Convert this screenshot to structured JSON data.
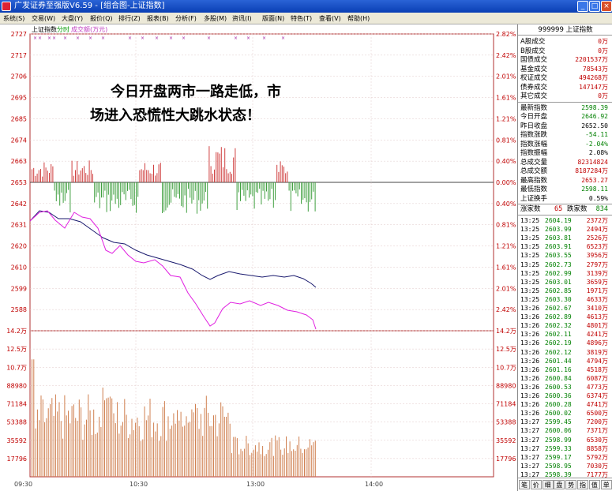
{
  "window": {
    "title": "广发证券至强版V6.59 - [组合图-上证指数]",
    "btn_min": "_",
    "btn_max": "□",
    "btn_close": "×"
  },
  "menu": [
    "系统(S)",
    "交易(W)",
    "大盘(Y)",
    "报价(Q)",
    "排行(Z)",
    "报表(B)",
    "分析(F)",
    "多股(M)",
    "资讯(I)",
    "版面(N)",
    "特色(T)",
    "查看(V)",
    "帮助(H)"
  ],
  "chart": {
    "index_name": "上证指数",
    "mode": "分时",
    "volume_label": "成交额(万元)",
    "price_ticks": [
      "2727",
      "2717",
      "2706",
      "2695",
      "2685",
      "2674",
      "2663",
      "2653",
      "2642",
      "2631",
      "2620",
      "2610",
      "2599",
      "2588"
    ],
    "pct_ticks": [
      "2.82%",
      "2.42%",
      "2.01%",
      "1.61%",
      "1.21%",
      "0.81%",
      "0.40%",
      "0.00%",
      "0.40%",
      "0.81%",
      "1.21%",
      "1.61%",
      "2.01%",
      "2.42%"
    ],
    "vol_ticks": [
      "14.2万",
      "12.5万",
      "10.7万",
      "88980",
      "71184",
      "53388",
      "35592",
      "17796"
    ],
    "time_ticks": [
      "09:30",
      "10:30",
      "13:00",
      "14:00"
    ],
    "series_colors": {
      "index": "#1a1a6e",
      "avg": "#e020e0",
      "up": "#d04040",
      "down": "#40a040",
      "volume": "#d08050"
    }
  },
  "annotation": {
    "line1": "今日开盘两市一路走低，市",
    "line2": "场进入恐慌性大跳水状态！"
  },
  "panel": {
    "code": "999999",
    "name": "上证指数",
    "rows": [
      {
        "k": "A股成交",
        "v": "0万",
        "c": "red"
      },
      {
        "k": "B股成交",
        "v": "0万",
        "c": "red"
      },
      {
        "k": "国债成交",
        "v": "2201537万",
        "c": "red"
      },
      {
        "k": "基金成交",
        "v": "78543万",
        "c": "red"
      },
      {
        "k": "权证成交",
        "v": "494268万",
        "c": "red"
      },
      {
        "k": "债券成交",
        "v": "147147万",
        "c": "red"
      },
      {
        "k": "其它成交",
        "v": "0万",
        "c": "red"
      }
    ],
    "rows2": [
      {
        "k": "最新指数",
        "v": "2598.39",
        "c": "green"
      },
      {
        "k": "今日开盘",
        "v": "2646.92",
        "c": "green"
      },
      {
        "k": "昨日收盘",
        "v": "2652.50",
        "c": "black"
      },
      {
        "k": "指数涨跌",
        "v": "-54.11",
        "c": "green"
      },
      {
        "k": "指数涨幅",
        "v": "-2.04%",
        "c": "green"
      },
      {
        "k": "指数振幅",
        "v": "2.08%",
        "c": "black"
      },
      {
        "k": "总成交量",
        "v": "82314824",
        "c": "red"
      },
      {
        "k": "总成交额",
        "v": "8187284万",
        "c": "red"
      },
      {
        "k": "最高指数",
        "v": "2653.27",
        "c": "red"
      },
      {
        "k": "最低指数",
        "v": "2598.11",
        "c": "green"
      },
      {
        "k": "上证换手",
        "v": "0.59%",
        "c": "black"
      }
    ],
    "rise_label": "涨家数",
    "rise_count": "65",
    "fall_label": "跌家数",
    "fall_count": "834",
    "ticks": [
      {
        "t": "13:25",
        "p": "2604.19",
        "v": "2372万"
      },
      {
        "t": "13:25",
        "p": "2603.99",
        "v": "2494万"
      },
      {
        "t": "13:25",
        "p": "2603.81",
        "v": "2526万"
      },
      {
        "t": "13:25",
        "p": "2603.91",
        "v": "6523万"
      },
      {
        "t": "13:25",
        "p": "2603.55",
        "v": "3956万"
      },
      {
        "t": "13:25",
        "p": "2602.73",
        "v": "2797万"
      },
      {
        "t": "13:25",
        "p": "2602.99",
        "v": "3139万"
      },
      {
        "t": "13:25",
        "p": "2603.01",
        "v": "3659万"
      },
      {
        "t": "13:25",
        "p": "2602.85",
        "v": "1971万"
      },
      {
        "t": "13:25",
        "p": "2603.30",
        "v": "4633万"
      },
      {
        "t": "13:26",
        "p": "2602.67",
        "v": "3410万"
      },
      {
        "t": "13:26",
        "p": "2602.89",
        "v": "4613万"
      },
      {
        "t": "13:26",
        "p": "2602.32",
        "v": "4801万"
      },
      {
        "t": "13:26",
        "p": "2602.11",
        "v": "4241万"
      },
      {
        "t": "13:26",
        "p": "2602.19",
        "v": "4896万"
      },
      {
        "t": "13:26",
        "p": "2602.12",
        "v": "3819万"
      },
      {
        "t": "13:26",
        "p": "2601.44",
        "v": "4794万"
      },
      {
        "t": "13:26",
        "p": "2601.16",
        "v": "4518万"
      },
      {
        "t": "13:26",
        "p": "2600.84",
        "v": "6087万"
      },
      {
        "t": "13:26",
        "p": "2600.53",
        "v": "4773万"
      },
      {
        "t": "13:26",
        "p": "2600.36",
        "v": "6374万"
      },
      {
        "t": "13:26",
        "p": "2600.28",
        "v": "4741万"
      },
      {
        "t": "13:26",
        "p": "2600.02",
        "v": "6500万"
      },
      {
        "t": "13:27",
        "p": "2599.45",
        "v": "7200万"
      },
      {
        "t": "13:27",
        "p": "2600.06",
        "v": "7371万"
      },
      {
        "t": "13:27",
        "p": "2598.99",
        "v": "6530万"
      },
      {
        "t": "13:27",
        "p": "2599.33",
        "v": "8858万"
      },
      {
        "t": "13:27",
        "p": "2599.17",
        "v": "5792万"
      },
      {
        "t": "13:27",
        "p": "2598.95",
        "v": "7030万"
      },
      {
        "t": "13:27",
        "p": "2598.39",
        "v": "7177万"
      }
    ],
    "tabs": [
      "笔",
      "价",
      "细",
      "盘",
      "势",
      "指",
      "值",
      "单"
    ]
  }
}
